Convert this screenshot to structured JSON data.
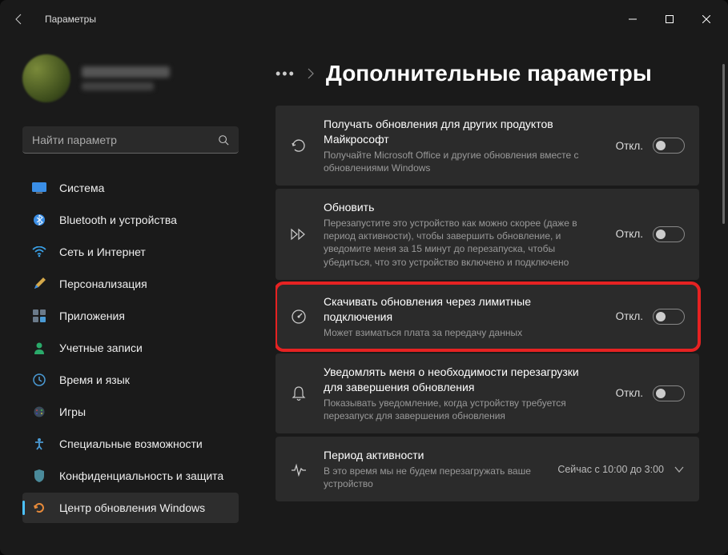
{
  "window": {
    "title": "Параметры"
  },
  "search": {
    "placeholder": "Найти параметр"
  },
  "nav": [
    {
      "id": "system",
      "label": "Система"
    },
    {
      "id": "bluetooth",
      "label": "Bluetooth и устройства"
    },
    {
      "id": "network",
      "label": "Сеть и Интернет"
    },
    {
      "id": "personalize",
      "label": "Персонализация"
    },
    {
      "id": "apps",
      "label": "Приложения"
    },
    {
      "id": "accounts",
      "label": "Учетные записи"
    },
    {
      "id": "time",
      "label": "Время и язык"
    },
    {
      "id": "gaming",
      "label": "Игры"
    },
    {
      "id": "accessibility",
      "label": "Специальные возможности"
    },
    {
      "id": "privacy",
      "label": "Конфиденциальность и защита"
    },
    {
      "id": "update",
      "label": "Центр обновления Windows"
    }
  ],
  "breadcrumb": {
    "title": "Дополнительные параметры"
  },
  "toggle_off": "Откл.",
  "settings": [
    {
      "id": "other-products",
      "title": "Получать обновления для других продуктов Майкрософт",
      "desc": "Получайте Microsoft Office и другие обновления вместе с обновлениями Windows"
    },
    {
      "id": "restart-asap",
      "title": "Обновить",
      "desc": "Перезапустите это устройство как можно скорее (даже в период активности), чтобы завершить обновление, и уведомите меня за 15 минут до перезапуска, чтобы убедиться, что это устройство включено и подключено"
    },
    {
      "id": "metered",
      "title": "Скачивать обновления через лимитные подключения",
      "desc": "Может взиматься плата за передачу данных"
    },
    {
      "id": "notify-restart",
      "title": "Уведомлять меня о необходимости перезагрузки для завершения обновления",
      "desc": "Показывать уведомление, когда устройству требуется перезапуск для завершения обновления"
    },
    {
      "id": "active-hours",
      "title": "Период активности",
      "desc": "В это время мы не будем перезагружать ваше устройство",
      "value": "Сейчас с 10:00 до 3:00"
    }
  ]
}
